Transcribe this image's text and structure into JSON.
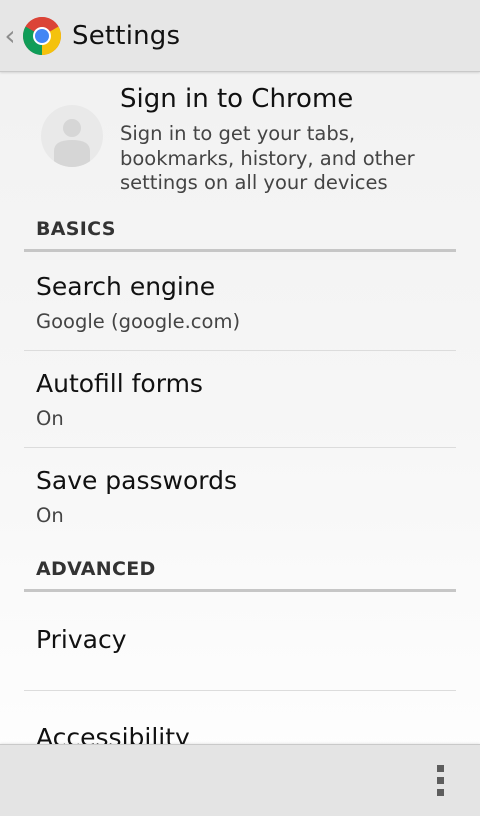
{
  "header": {
    "title": "Settings",
    "up_caret": "‹"
  },
  "signin": {
    "title": "Sign in to Chrome",
    "description": "Sign in to get your tabs, bookmarks, history, and other settings on all your devices"
  },
  "sections": {
    "basics": "BASICS",
    "advanced": "ADVANCED"
  },
  "prefs": {
    "search_engine": {
      "title": "Search engine",
      "summary": "Google (google.com)"
    },
    "autofill": {
      "title": "Autofill forms",
      "summary": "On"
    },
    "passwords": {
      "title": "Save passwords",
      "summary": "On"
    },
    "privacy": {
      "title": "Privacy"
    },
    "accessibility": {
      "title": "Accessibility"
    }
  },
  "icons": {
    "app": "chrome-logo-icon",
    "avatar": "person-avatar-icon",
    "menu": "overflow-menu-icon"
  },
  "colors": {
    "chrome_red": "#db4437",
    "chrome_yellow": "#f4c20d",
    "chrome_green": "#0f9d58",
    "chrome_blue": "#4285f4"
  }
}
